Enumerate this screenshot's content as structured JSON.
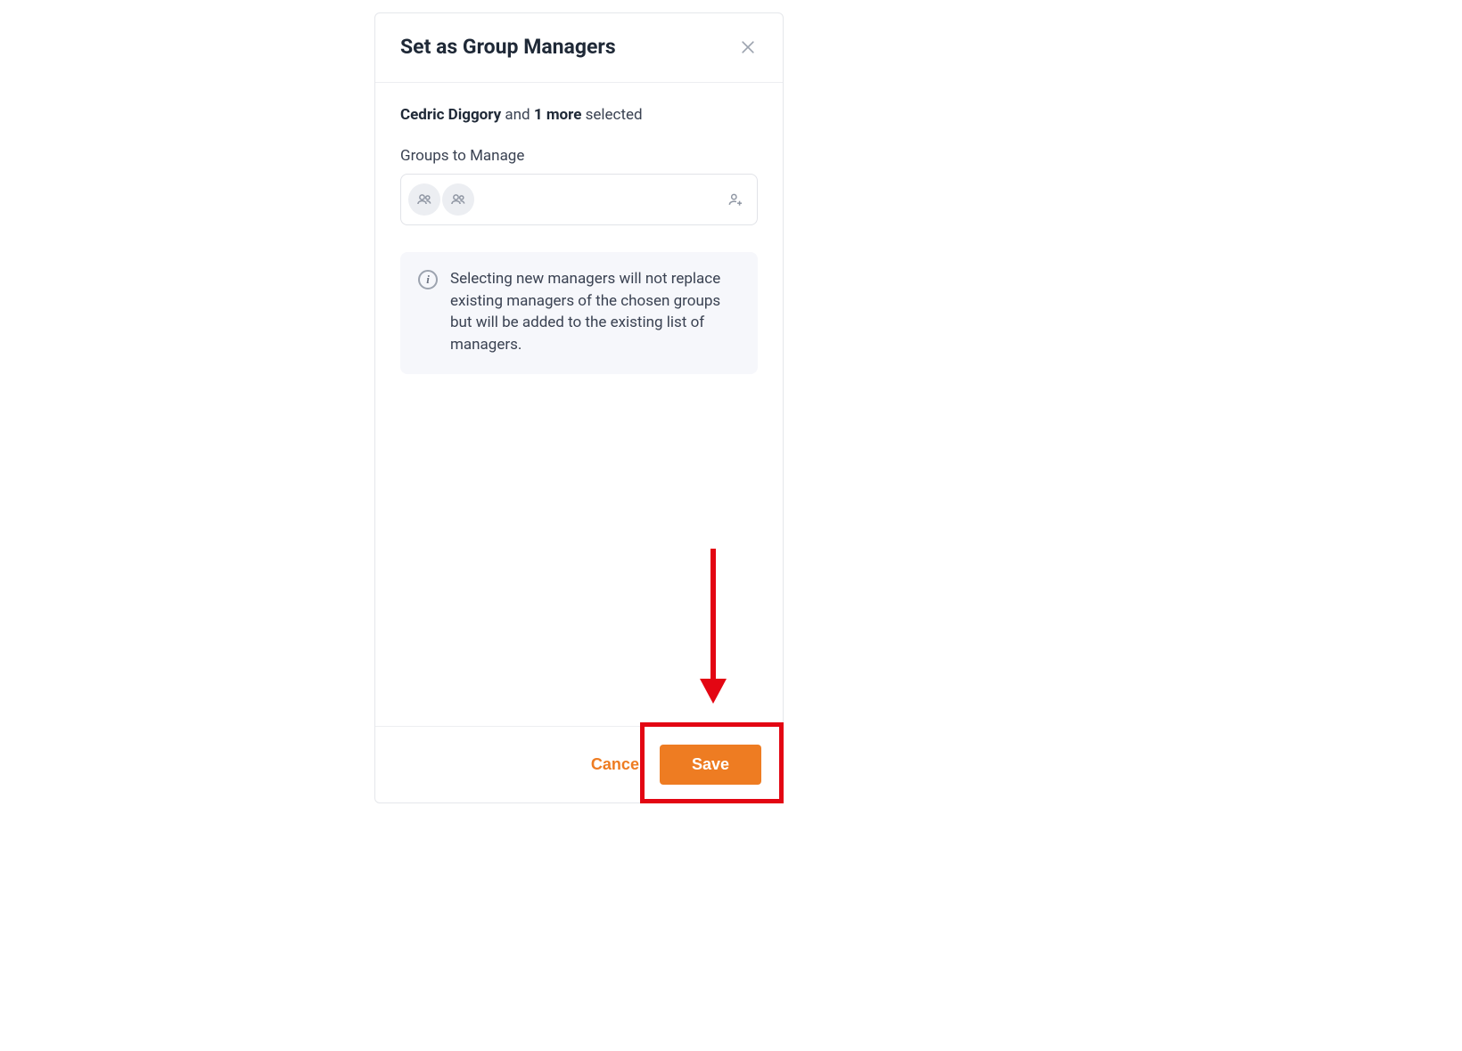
{
  "modal": {
    "title": "Set as Group Managers",
    "selection": {
      "name": "Cedric Diggory",
      "connector": " and ",
      "more": "1 more",
      "suffix": " selected"
    },
    "field_label": "Groups to Manage",
    "info_text": "Selecting new managers will not replace existing managers of the chosen groups but will be added to the existing list of managers.",
    "footer": {
      "cancel": "Cancel",
      "save": "Save"
    }
  },
  "annotation": {
    "highlight_color": "#e30613",
    "arrow_color": "#e30613"
  }
}
